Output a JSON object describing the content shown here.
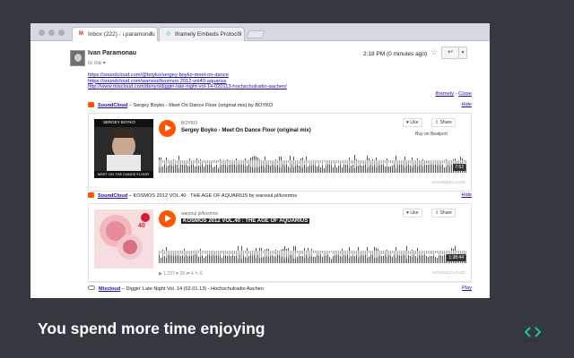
{
  "browser": {
    "tabs": [
      {
        "label": "Inbox (222) - i.paramonau",
        "icon": "gmail-icon",
        "active": true
      },
      {
        "label": "Iframely Embeds Protocol",
        "icon": "iframely-icon",
        "active": false
      }
    ]
  },
  "email": {
    "sender": "Ivan Paramonau",
    "to": "to me",
    "time": "2:18 PM (0 minutes ago)",
    "links": [
      "https://soundcloud.com/@boyko/sergey-boyko-meet-on-dance",
      "https://soundcloud.com/warsoul/kosmos-2012-vol40-aquarius",
      "http://www.mixcloud.com/denyo/diggin-late-night-vol-14-020113-hochschulradio-aachen/"
    ]
  },
  "iframely_bar": {
    "brand": "Iframely",
    "separator": " - ",
    "close": "Close"
  },
  "embeds": [
    {
      "source": "SoundCloud",
      "title": " – Sergey Boyko - Meet On Dance Floor (original mix) by BOYKO",
      "hide": "Hide",
      "uploader": "BOYKO",
      "track": "Sergey Boyko - Meet On Dance Floor (original mix)",
      "like": "Like",
      "share": "Share",
      "buy": "Buy on Beatport",
      "duration": "7:52",
      "art_caption_top": "SERGEY BOYKO",
      "art_caption_bottom": "MEET ON THE DANCE FLOOR",
      "footer": "SOUNDCLOUD"
    },
    {
      "source": "SoundCloud",
      "title": " – KOSMOS 2012 VOL.40 : THE AGE OF AQUARIUS by warsoul.pl/kosmos",
      "hide": "Hide",
      "uploader": "warsoul.pl/kosmos",
      "track": "KOSMOS 2012 VOL.40 : THE AGE OF AQUARIUS",
      "like": "Like",
      "share": "Share",
      "duration": "1:38:44",
      "badge": "40",
      "stats": "▶ 1,237   ♥ 28   ⇄ 4   ✎ 6",
      "footer": "SOUNDCLOUD"
    }
  ],
  "mixcloud": {
    "source": "Mixcloud",
    "title": " – Diggin' Late Night Vol. 14 (02.01.13) - Hochschulradio Aachen",
    "play": "Play"
  },
  "tagline": "You spend more time enjoying",
  "colors": {
    "background": "#34383f",
    "soundcloud": "#ff5500",
    "link": "#1a0dab",
    "logo": "#21c4b0"
  }
}
